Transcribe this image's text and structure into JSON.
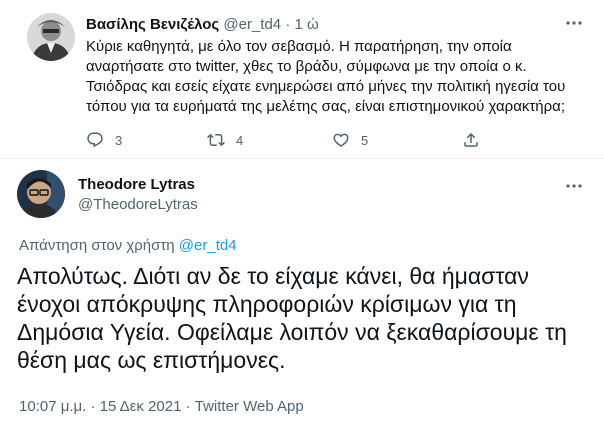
{
  "parent": {
    "name": "Βασίλης Βενιζέλος",
    "handle": "@er_td4",
    "separator": "·",
    "time": "1 ώ",
    "text": "Κύριε καθηγητά, με όλο τον σεβασμό. Η παρατήρηση, την οποία αναρτήσατε στο twitter, χθες το βράδυ, σύμφωνα με την οποία ο κ. Τσιόδρας και εσείς είχατε ενημερώσει από μήνες την πολιτική ηγεσία του τόπου για τα ευρήματά της μελέτης σας, είναι επιστημονικού χαρακτήρα;",
    "actions": {
      "reply_icon": "reply-icon",
      "reply_count": "3",
      "retweet_icon": "retweet-icon",
      "retweet_count": "4",
      "like_icon": "heart-icon",
      "like_count": "5",
      "share_icon": "share-icon"
    },
    "more_icon": "more-icon"
  },
  "main": {
    "name": "Theodore Lytras",
    "handle": "@TheodoreLytras",
    "more_icon": "more-icon",
    "reply_prefix": "Απάντηση στον χρήστη",
    "reply_handle": "@er_td4",
    "text": "Απολύτως. Διότι αν δε το είχαμε κάνει, θα ήμασταν ένοχοι απόκρυψης πληροφοριών κρίσιμων για τη Δημόσια Υγεία. Οφείλαμε λοιπόν να ξεκαθαρίσουμε τη θέση μας ως επιστήμονες.",
    "timestamp": "10:07 μ.μ. · 15 Δεκ 2021 · Twitter Web App"
  },
  "colors": {
    "text": "#0f1419",
    "muted": "#536471",
    "link": "#1d9bf0",
    "border": "#eff3f4"
  }
}
